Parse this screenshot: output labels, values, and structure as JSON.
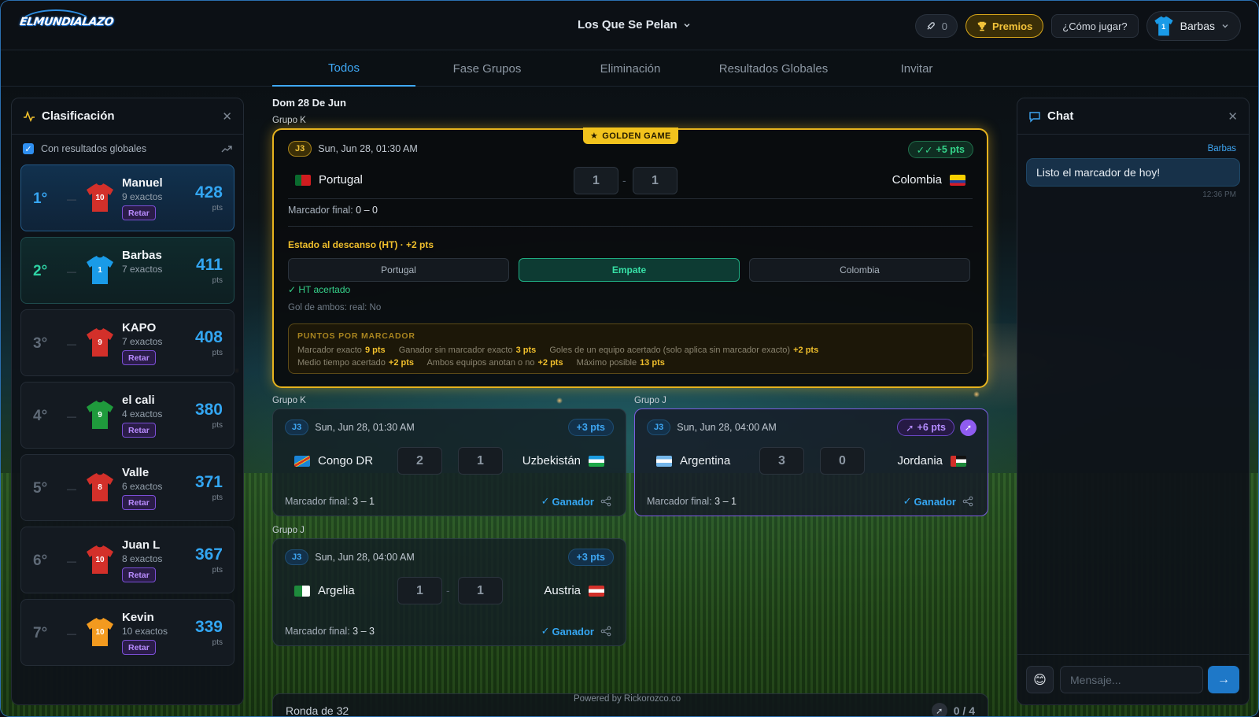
{
  "app": {
    "logo_text": "ELMUNDIALAZO"
  },
  "header": {
    "league": "Los Que Se Pelan",
    "boost_count": "0",
    "premios": "Premios",
    "como_jugar": "¿Cómo jugar?",
    "user": "Barbas",
    "user_number": "1"
  },
  "tabs": [
    "Todos",
    "Fase Grupos",
    "Eliminación",
    "Resultados Globales",
    "Invitar"
  ],
  "standings": {
    "title": "Clasificación",
    "global_label": "Con resultados globales",
    "global_checked": true,
    "retar_label": "Retar",
    "pts_label": "pts",
    "rows": [
      {
        "pos": "1°",
        "name": "Manuel",
        "exactos": "9 exactos",
        "pts": "428",
        "jersey_color": "#d3302a",
        "number": "10",
        "retar": true
      },
      {
        "pos": "2°",
        "name": "Barbas",
        "exactos": "7 exactos",
        "pts": "411",
        "jersey_color": "#1a9be8",
        "number": "1",
        "retar": false
      },
      {
        "pos": "3°",
        "name": "KAPO",
        "exactos": "7 exactos",
        "pts": "408",
        "jersey_color": "#d3302a",
        "number": "9",
        "retar": true
      },
      {
        "pos": "4°",
        "name": "el cali",
        "exactos": "4 exactos",
        "pts": "380",
        "jersey_color": "#1f9a3c",
        "number": "9",
        "retar": true
      },
      {
        "pos": "5°",
        "name": "Valle",
        "exactos": "6 exactos",
        "pts": "371",
        "jersey_color": "#d3302a",
        "number": "8",
        "retar": true
      },
      {
        "pos": "6°",
        "name": "Juan L",
        "exactos": "8 exactos",
        "pts": "367",
        "jersey_color": "#d3302a",
        "number": "10",
        "retar": true
      },
      {
        "pos": "7°",
        "name": "Kevin",
        "exactos": "10 exactos",
        "pts": "339",
        "jersey_color": "#f39a1f",
        "number": "10",
        "retar": true
      }
    ]
  },
  "main": {
    "day": "Dom 28 De Jun",
    "golden": {
      "group": "Grupo K",
      "badge": "GOLDEN GAME",
      "round": "J3",
      "date": "Sun, Jun 28, 01:30 AM",
      "gain": "+5 pts",
      "home": "Portugal",
      "away": "Colombia",
      "pred_home": "1",
      "pred_away": "1",
      "final_label": "Marcador final:",
      "final_score": "0 – 0",
      "ht_title": "Estado al descanso (HT) · +2 pts",
      "ht_options": [
        "Portugal",
        "Empate",
        "Colombia"
      ],
      "ht_selected": "Empate",
      "ht_result": "✓ HT acertado",
      "both_label": "Gol de ambos: real: No",
      "points": {
        "title": "PUNTOS POR MARCADOR",
        "line1": [
          {
            "label": "Marcador exacto",
            "value": "9 pts"
          },
          {
            "label": "Ganador sin marcador exacto",
            "value": "3 pts"
          },
          {
            "label": "Goles de un equipo acertado (solo aplica sin marcador exacto)",
            "value": "+2 pts"
          }
        ],
        "line2": [
          {
            "label": "Medio tiempo acertado",
            "value": "+2 pts"
          },
          {
            "label": "Ambos equipos anotan o no",
            "value": "+2 pts"
          },
          {
            "label": "Máximo posible",
            "value": "13 pts"
          }
        ]
      }
    },
    "matches": [
      {
        "group": "Grupo K",
        "round": "J3",
        "date": "Sun, Jun 28, 01:30 AM",
        "gain": "+3 pts",
        "home": "Congo DR",
        "away": "Uzbekistán",
        "pred_home": "2",
        "pred_away": "1",
        "final_label": "Marcador final:",
        "final_score": "3 – 1",
        "result": "Ganador"
      },
      {
        "group": "Grupo J",
        "round": "J3",
        "date": "Sun, Jun 28, 04:00 AM",
        "gain": "+6 pts",
        "home": "Argentina",
        "away": "Jordania",
        "pred_home": "3",
        "pred_away": "0",
        "final_label": "Marcador final:",
        "final_score": "3 – 1",
        "result": "Ganador"
      },
      {
        "group": "Grupo J",
        "round": "J3",
        "date": "Sun, Jun 28, 04:00 AM",
        "gain": "+3 pts",
        "home": "Argelia",
        "away": "Austria",
        "pred_home": "1",
        "pred_away": "1",
        "final_label": "Marcador final:",
        "final_score": "3 – 3",
        "result": "Ganador"
      }
    ],
    "ronda": {
      "title": "Ronda de 32",
      "count": "0 / 4"
    },
    "powered": "Powered by Rickorozco.co"
  },
  "chat": {
    "title": "Chat",
    "messages": [
      {
        "user": "Barbas",
        "text": "Listo el marcador de hoy!",
        "time": "12:36 PM"
      }
    ],
    "placeholder": "Mensaje..."
  },
  "colors": {
    "accent": "#3fa8f5",
    "gold": "#f2c31d",
    "green": "#35d48a",
    "purple": "#8f5cf0"
  }
}
